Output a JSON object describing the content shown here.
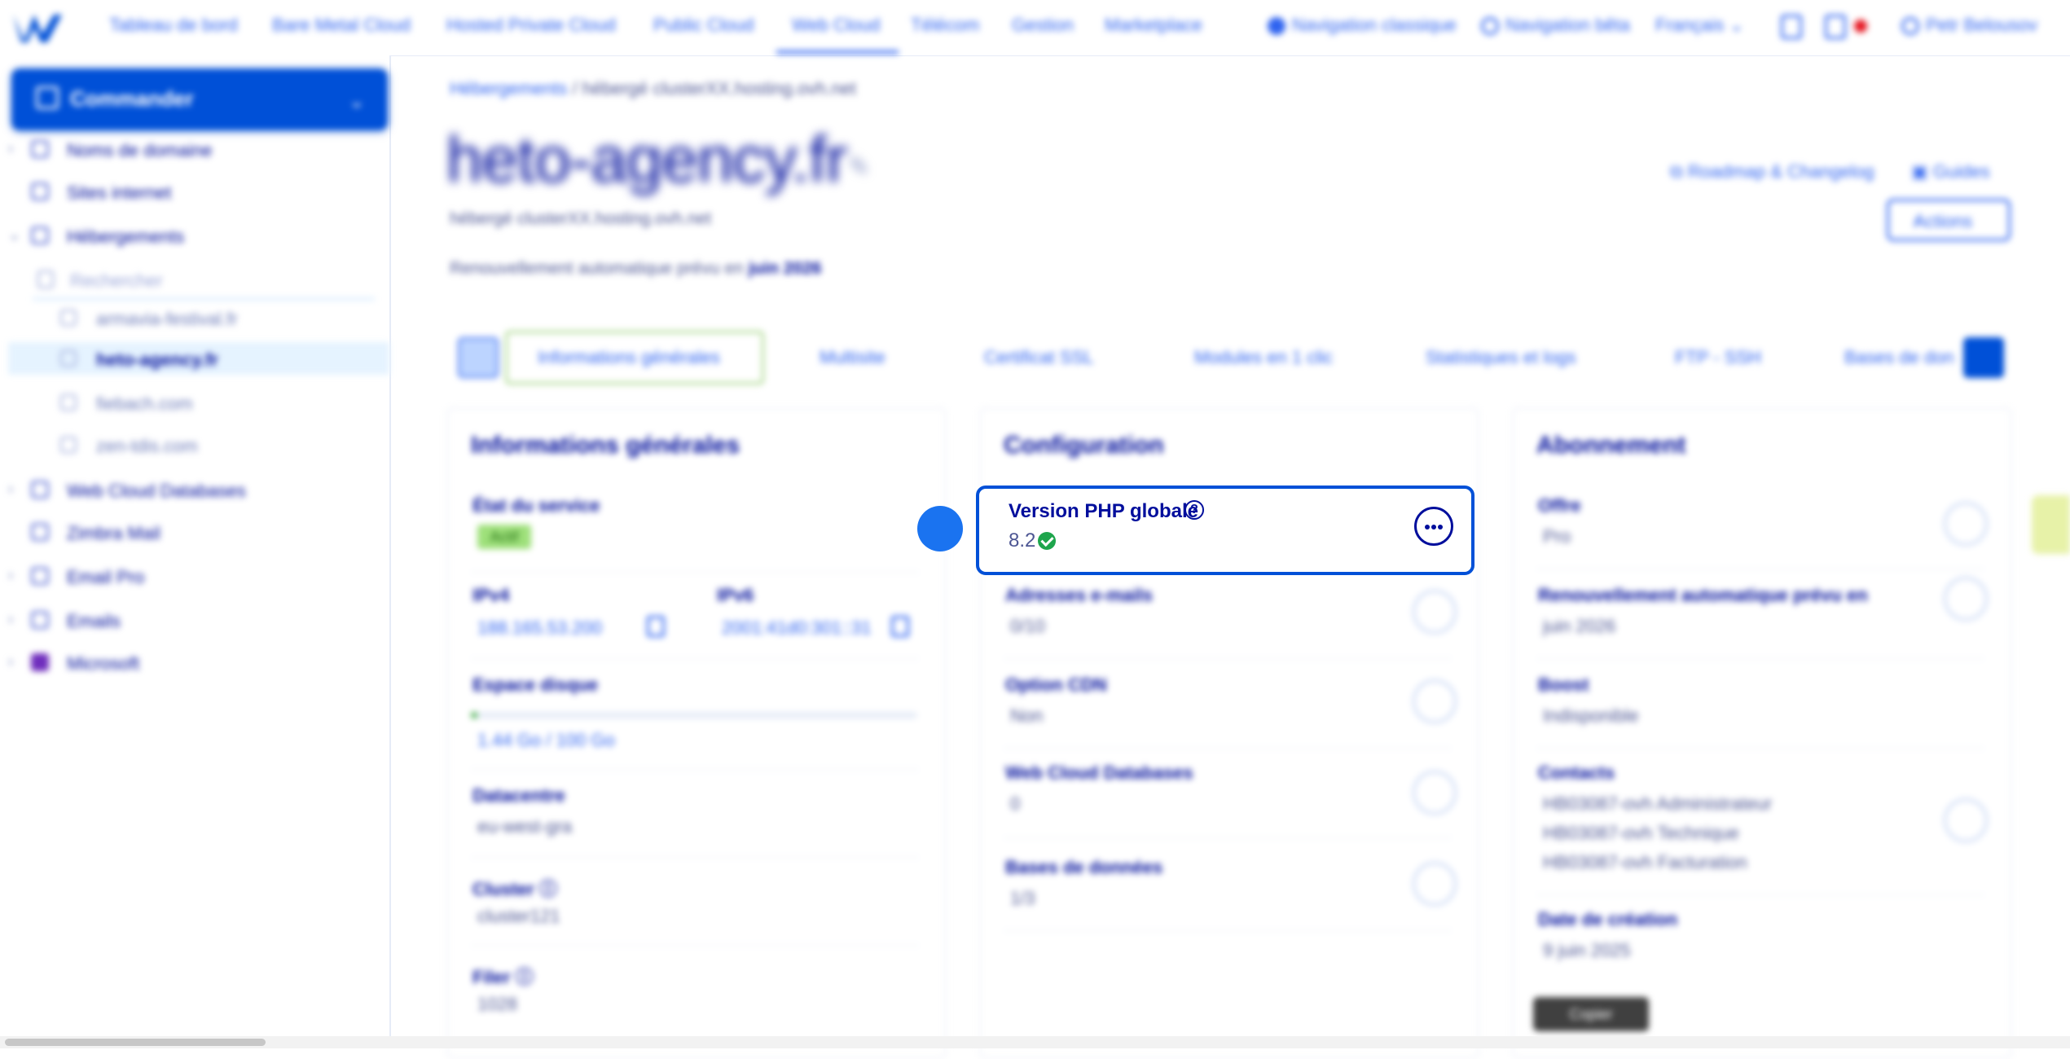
{
  "topnav": {
    "items": [
      "Tableau de bord",
      "Bare Metal Cloud",
      "Hosted Private Cloud",
      "Public Cloud",
      "Web Cloud",
      "Télécom",
      "Gestion",
      "Marketplace"
    ],
    "active_index": 4,
    "classic_nav": "Navigation classique",
    "beta_nav": "Navigation bêta",
    "language": "Français",
    "account": "Petr Belousov"
  },
  "sidebar": {
    "order_label": "Commander",
    "items": [
      {
        "label": "Noms de domaine"
      },
      {
        "label": "Sites internet"
      },
      {
        "label": "Hébergements"
      },
      {
        "label": "Web Cloud Databases"
      },
      {
        "label": "Zimbra Mail"
      },
      {
        "label": "Email Pro"
      },
      {
        "label": "Emails"
      },
      {
        "label": "Microsoft"
      }
    ],
    "search_placeholder": "Rechercher",
    "sub_items": [
      "armavia-festival.fr",
      "heto-agency.fr",
      "fiebach.com",
      "zen-tdis.com"
    ],
    "active_sub": 1
  },
  "header": {
    "breadcrumb_link": "Hébergements",
    "breadcrumb_current": "/ hébergé clusterXX.hosting.ovh.net",
    "title": "heto-agency.fr",
    "subtitle": "hébergé clusterXX.hosting.ovh.net",
    "renewal_text": "Renouvellement automatique prévu en",
    "renewal_date": "juin 2026",
    "roadmap_link": "Roadmap & Changelog",
    "guides_link": "Guides",
    "actions_label": "Actions"
  },
  "tabs": [
    "Informations générales",
    "Multisite",
    "Certificat SSL",
    "Modules en 1 clic",
    "Statistiques et logs",
    "FTP - SSH",
    "Bases de don"
  ],
  "general_card": {
    "title": "Informations générales",
    "service_state_label": "État du service",
    "service_state_value": "Actif",
    "ipv4_label": "IPv4",
    "ipv4_value": "188.165.53.200",
    "ipv6_label": "IPv6",
    "ipv6_value": "2001:41d0:301::31",
    "disk_label": "Espace disque",
    "disk_value": "1.44 Go / 100 Go",
    "disk_fraction": 0.0144,
    "datacenter_label": "Datacentre",
    "datacenter_value": "eu-west-gra",
    "cluster_label": "Cluster",
    "cluster_value": "cluster121",
    "filer_label": "Filer",
    "filer_value": "1028"
  },
  "config_card": {
    "title": "Configuration",
    "php_label": "Version PHP globale",
    "php_value": "8.2",
    "email_label": "Adresses e-mails",
    "email_value": "0/10",
    "cdn_label": "Option CDN",
    "cdn_value": "Non",
    "wcdb_label": "Web Cloud Databases",
    "wcdb_value": "0",
    "db_label": "Bases de données",
    "db_value": "1/3"
  },
  "subscription_card": {
    "title": "Abonnement",
    "offer_label": "Offre",
    "offer_value": "Pro",
    "renewal_label": "Renouvellement automatique prévu en",
    "renewal_value": "juin 2026",
    "boost_label": "Boost",
    "boost_value": "Indisponible",
    "contacts_label": "Contacts",
    "contacts": [
      "HB03087-ovh Administrateur",
      "HB03087-ovh Technique",
      "HB03087-ovh Facturation"
    ],
    "creation_label": "Date de création",
    "creation_value": "9 juin 2025"
  },
  "tooltip": "Copier",
  "colors": {
    "primary": "#0050d7",
    "brand": "#000e9c",
    "success": "#1ea54c",
    "link": "#2e63f0"
  }
}
